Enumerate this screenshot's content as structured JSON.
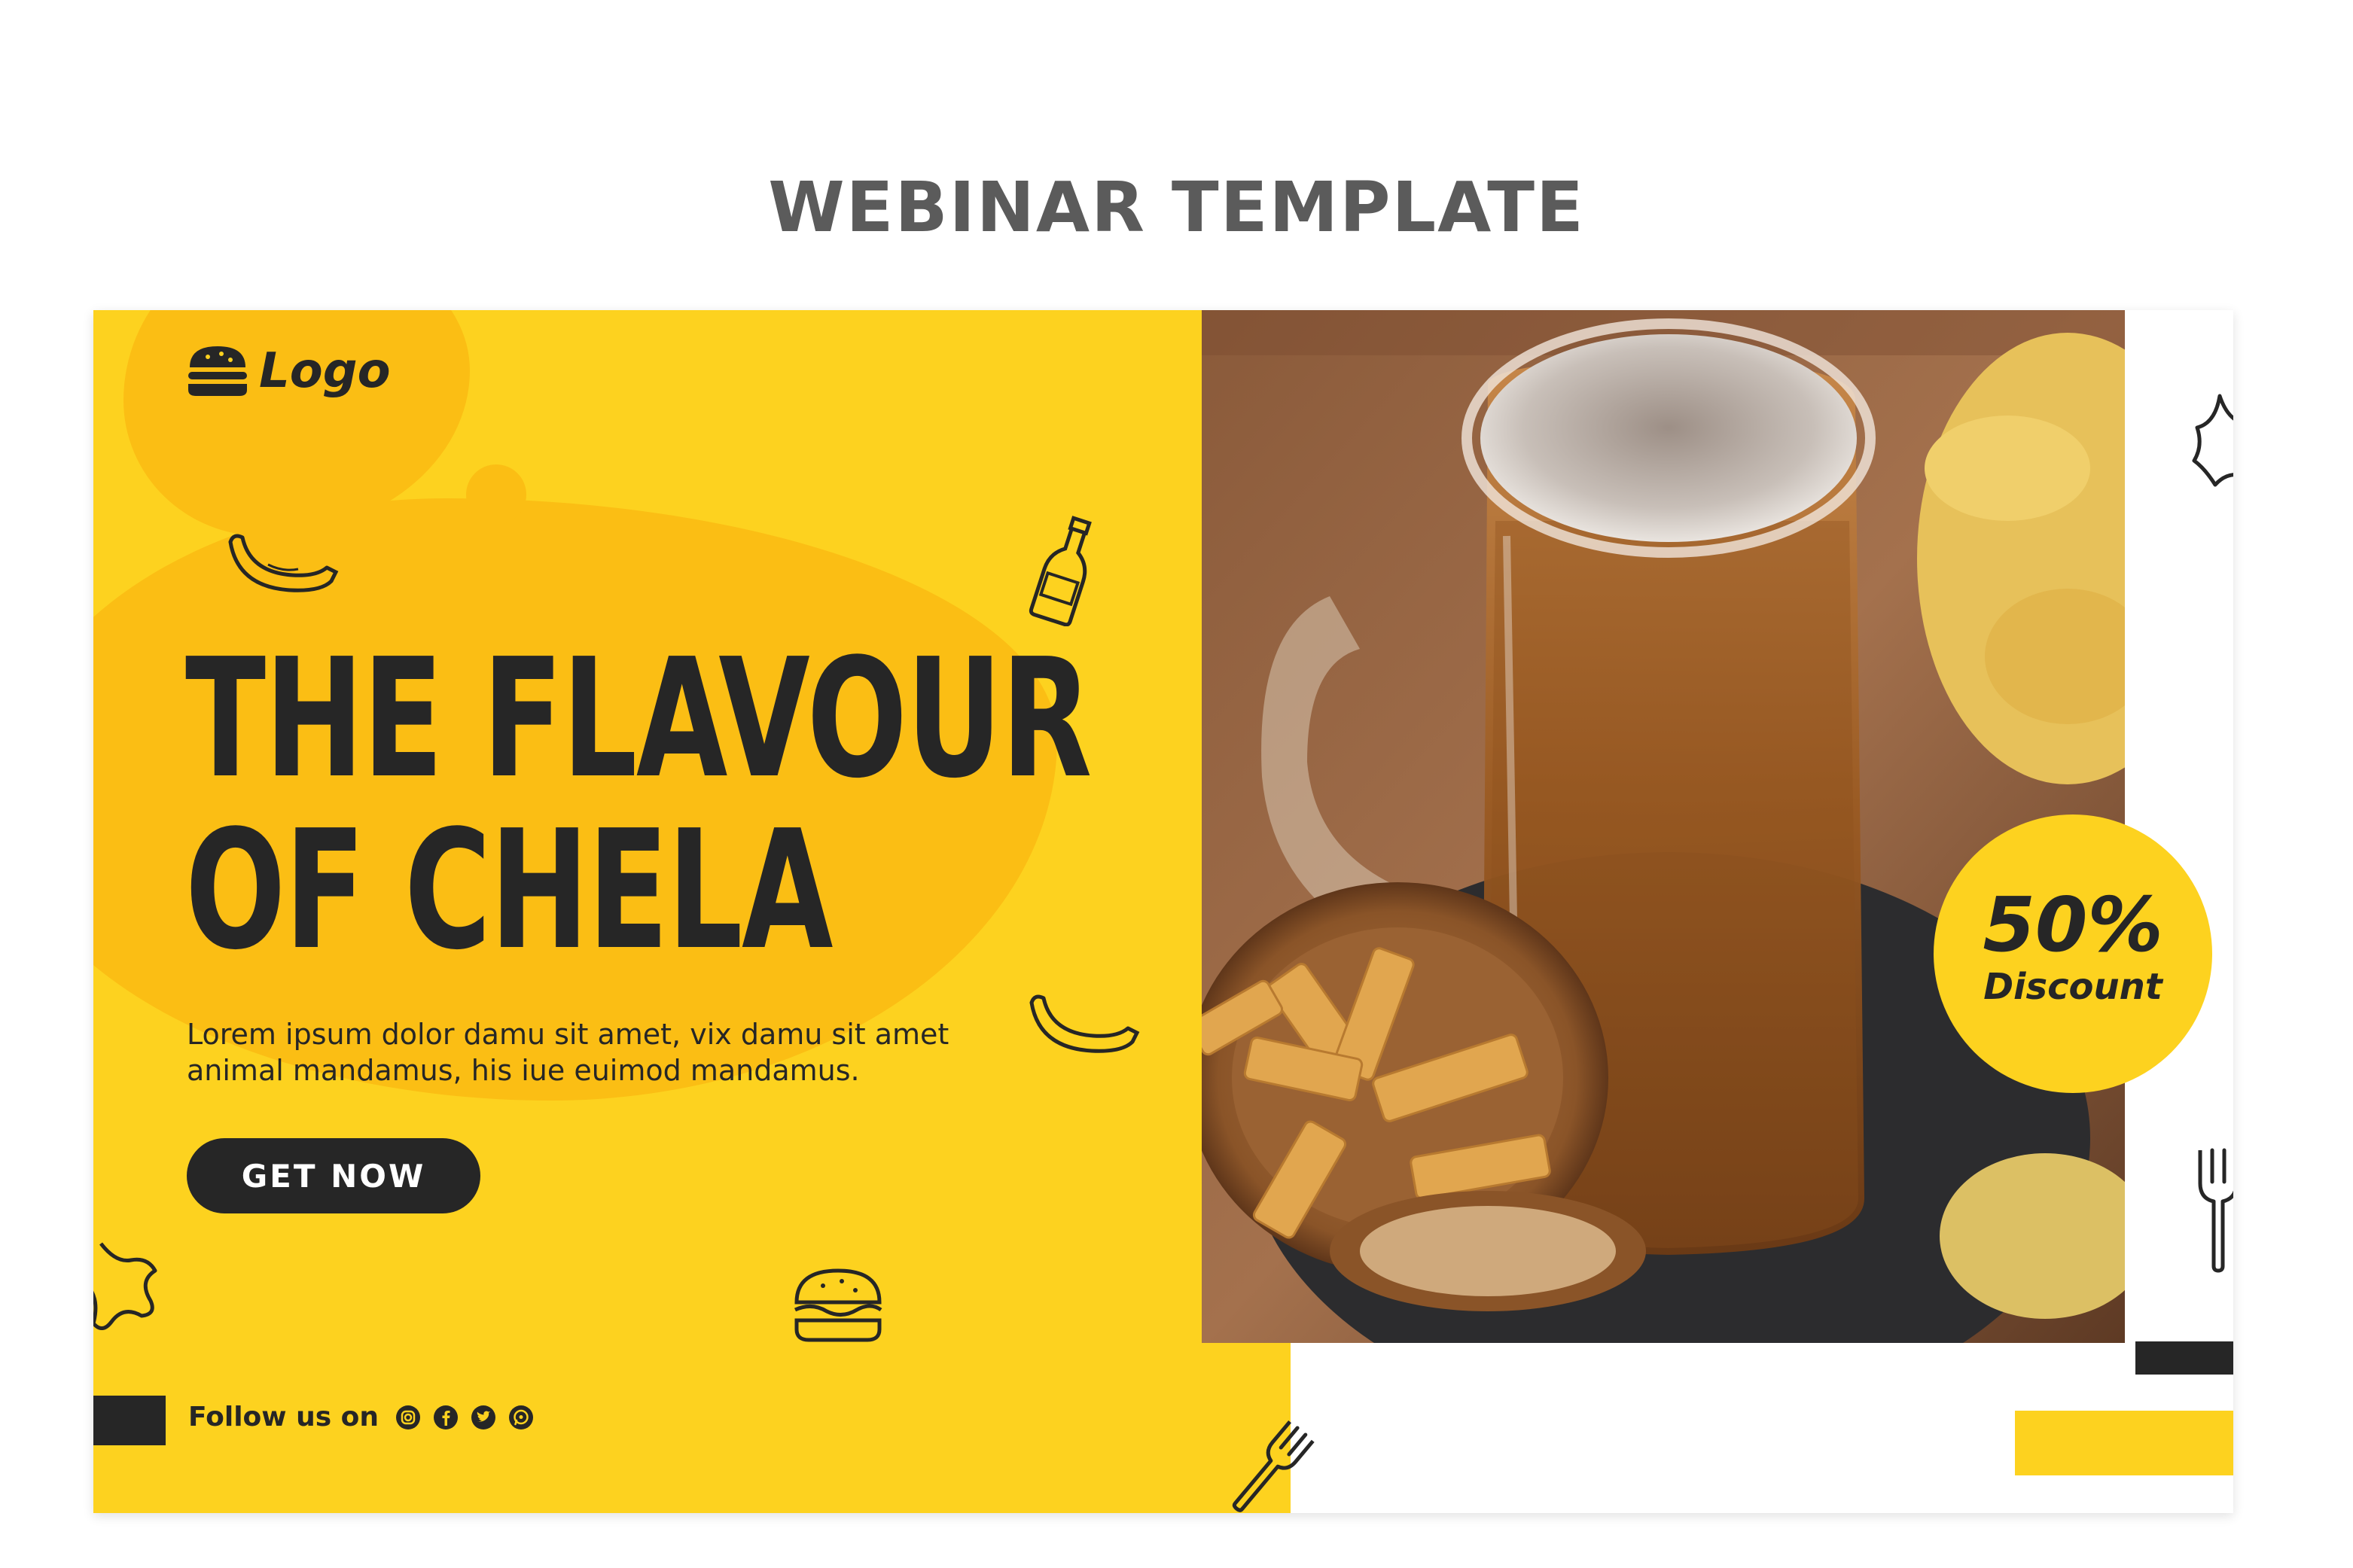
{
  "page": {
    "heading": "WEBINAR TEMPLATE"
  },
  "brand": {
    "logo_text": "Logo",
    "logo_icon": "burger-icon"
  },
  "hero": {
    "title_line1": "THE FLAVOUR",
    "title_line2": "OF CHELA",
    "body_line1": "Lorem ipsum dolor damu sit amet, vix damu  sit amet",
    "body_line2": "animal mandamus, his iue euimod mandamus.",
    "cta_label": "GET NOW"
  },
  "promo": {
    "value": "50%",
    "label": "Discount"
  },
  "social": {
    "label": "Follow us on",
    "icons": [
      "instagram-icon",
      "facebook-icon",
      "twitter-icon",
      "whatsapp-icon"
    ]
  },
  "colors": {
    "yellow": "#fdd21f",
    "yellow_dark": "#fbbe14",
    "ink": "#262626",
    "heading_gray": "#5b5b5b"
  }
}
